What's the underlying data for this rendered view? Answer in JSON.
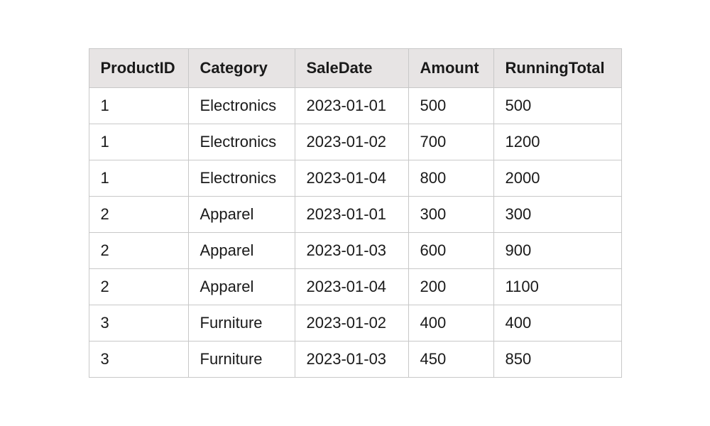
{
  "table": {
    "headers": [
      "ProductID",
      "Category",
      "SaleDate",
      "Amount",
      "RunningTotal"
    ],
    "rows": [
      {
        "ProductID": "1",
        "Category": "Electronics",
        "SaleDate": "2023-01-01",
        "Amount": "500",
        "RunningTotal": "500"
      },
      {
        "ProductID": "1",
        "Category": "Electronics",
        "SaleDate": "2023-01-02",
        "Amount": "700",
        "RunningTotal": "1200"
      },
      {
        "ProductID": "1",
        "Category": "Electronics",
        "SaleDate": "2023-01-04",
        "Amount": "800",
        "RunningTotal": "2000"
      },
      {
        "ProductID": "2",
        "Category": "Apparel",
        "SaleDate": "2023-01-01",
        "Amount": "300",
        "RunningTotal": "300"
      },
      {
        "ProductID": "2",
        "Category": "Apparel",
        "SaleDate": "2023-01-03",
        "Amount": "600",
        "RunningTotal": "900"
      },
      {
        "ProductID": "2",
        "Category": "Apparel",
        "SaleDate": "2023-01-04",
        "Amount": "200",
        "RunningTotal": "1100"
      },
      {
        "ProductID": "3",
        "Category": "Furniture",
        "SaleDate": "2023-01-02",
        "Amount": "400",
        "RunningTotal": "400"
      },
      {
        "ProductID": "3",
        "Category": "Furniture",
        "SaleDate": "2023-01-03",
        "Amount": "450",
        "RunningTotal": "850"
      }
    ]
  }
}
